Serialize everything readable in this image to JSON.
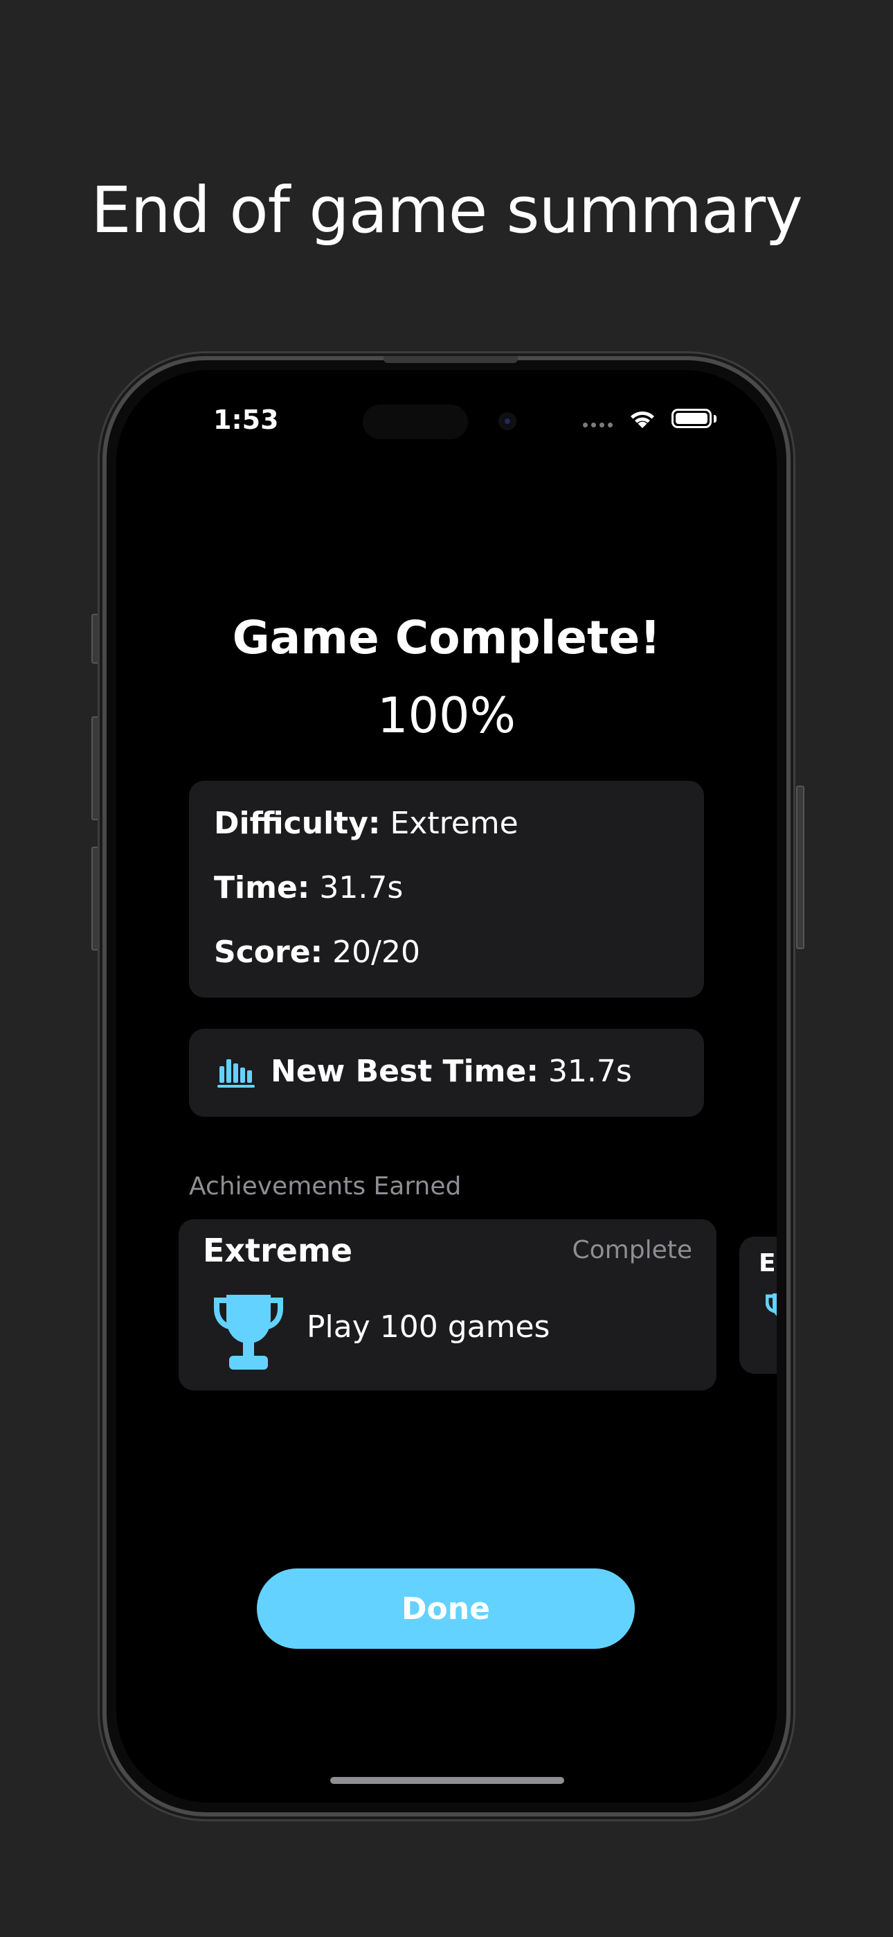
{
  "headline": "End of game summary",
  "status_bar": {
    "time": "1:53"
  },
  "summary": {
    "title": "Game Complete!",
    "percent": "100%",
    "stats": [
      {
        "label": "Difficulty:",
        "value": "Extreme"
      },
      {
        "label": "Time:",
        "value": "31.7s"
      },
      {
        "label": "Score:",
        "value": "20/20"
      }
    ]
  },
  "best": {
    "icon": "bar-chart-icon",
    "label": "New Best Time:",
    "value": "31.7s"
  },
  "achievements": {
    "section_label": "Achievements Earned",
    "items": [
      {
        "title": "Extreme",
        "status": "Complete",
        "icon": "trophy-icon",
        "description": "Play 100 games"
      },
      {
        "title": "E",
        "icon": "trophy-icon"
      }
    ]
  },
  "done_button": {
    "label": "Done"
  },
  "colors": {
    "accent": "#64d2ff",
    "card": "#1c1c1e",
    "background": "#242424",
    "secondary_text": "#8e8e93"
  }
}
